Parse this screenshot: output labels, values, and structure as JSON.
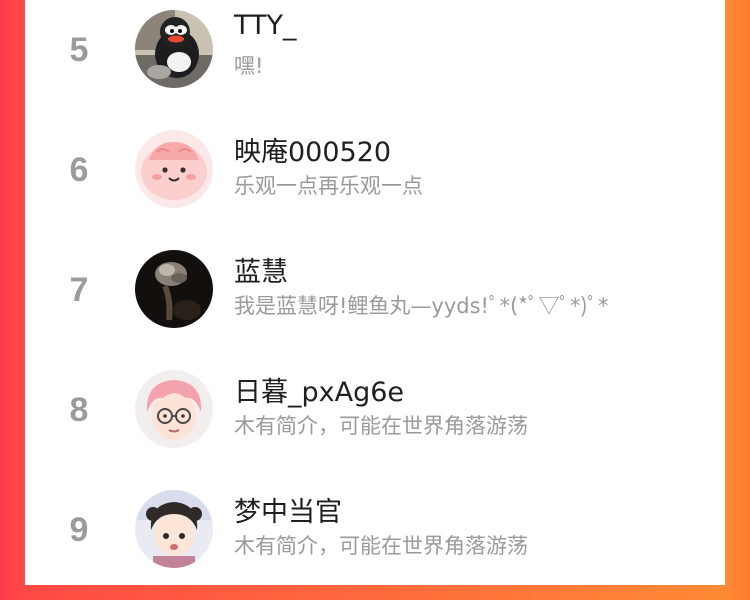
{
  "ranking": {
    "rows": [
      {
        "rank": "5",
        "name": "TTY_",
        "bio": "嘿!",
        "avatar_icon": "penguin-plush-avatar"
      },
      {
        "rank": "6",
        "name": "映庵000520",
        "bio": "乐观一点再乐观一点",
        "avatar_icon": "pink-blob-avatar"
      },
      {
        "rank": "7",
        "name": "蓝慧",
        "bio": "我是蓝慧呀!鲤鱼丸—yyds!ﾟ*(*ﾟ▽ﾟ*)ﾟ*",
        "avatar_icon": "dark-smoke-avatar"
      },
      {
        "rank": "8",
        "name": "日暮_pxAg6e",
        "bio": "木有简介，可能在世界角落游荡",
        "avatar_icon": "cartoon-glasses-boy-avatar"
      },
      {
        "rank": "9",
        "name": "梦中当官",
        "bio": "木有简介，可能在世界角落游荡",
        "avatar_icon": "cartoon-child-avatar"
      }
    ]
  },
  "colors": {
    "background_left": "#ff3a4d",
    "background_right": "#ff7a2e",
    "rank_text": "#9b9b9b",
    "name_text": "#1f1f1f",
    "bio_text": "#9a9a9a"
  }
}
